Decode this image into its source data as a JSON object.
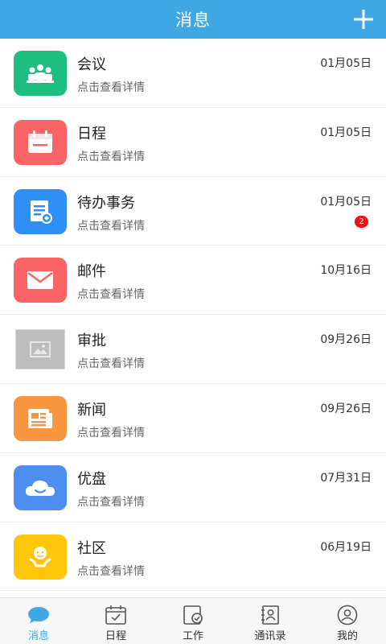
{
  "header": {
    "title": "消息"
  },
  "items": [
    {
      "name": "会议",
      "subtitle": "点击查看详情",
      "date": "01月05日",
      "icon": "meeting-icon",
      "color": "#1dbf7f"
    },
    {
      "name": "日程",
      "subtitle": "点击查看详情",
      "date": "01月05日",
      "icon": "calendar-icon",
      "color": "#fa6466"
    },
    {
      "name": "待办事务",
      "subtitle": "点击查看详情",
      "date": "01月05日",
      "icon": "todo-icon",
      "color": "#2e8ff5",
      "badge": "2"
    },
    {
      "name": "邮件",
      "subtitle": "点击查看详情",
      "date": "10月16日",
      "icon": "mail-icon",
      "color": "#fa6466"
    },
    {
      "name": "审批",
      "subtitle": "点击查看详情",
      "date": "09月26日",
      "icon": "image-placeholder-icon",
      "color": "#bdbdbd"
    },
    {
      "name": "新闻",
      "subtitle": "点击查看详情",
      "date": "09月26日",
      "icon": "news-icon",
      "color": "#fb9640"
    },
    {
      "name": "优盘",
      "subtitle": "点击查看详情",
      "date": "07月31日",
      "icon": "cloud-icon",
      "color": "#4c8ff0"
    },
    {
      "name": "社区",
      "subtitle": "点击查看详情",
      "date": "06月19日",
      "icon": "community-icon",
      "color": "#fec60a"
    }
  ],
  "tabs": [
    {
      "label": "消息",
      "icon": "chat-bubble-icon",
      "active": true
    },
    {
      "label": "日程",
      "icon": "calendar-check-icon"
    },
    {
      "label": "工作",
      "icon": "work-check-icon"
    },
    {
      "label": "通讯录",
      "icon": "contacts-icon"
    },
    {
      "label": "我的",
      "icon": "profile-icon"
    }
  ],
  "colors": {
    "primary": "#3ea7e6",
    "badge": "#ee1111"
  }
}
